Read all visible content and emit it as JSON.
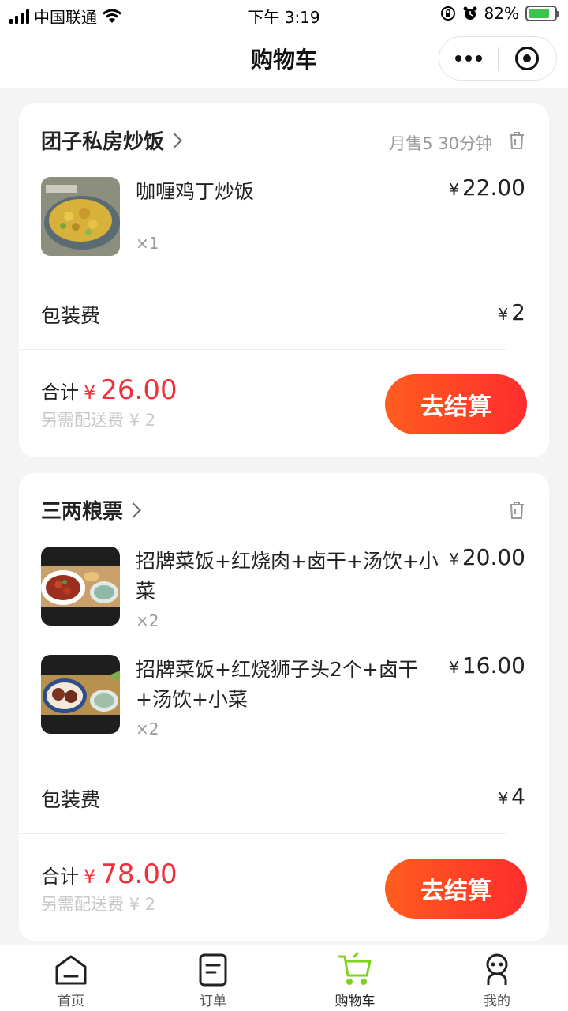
{
  "status_bar": {
    "carrier": "中国联通",
    "time": "下午 3:19",
    "battery_percent": "82%",
    "battery_level": 0.82
  },
  "nav": {
    "title": "购物车"
  },
  "shops": [
    {
      "name": "团子私房炒饭",
      "meta": "月售5  30分钟",
      "items": [
        {
          "name": "咖喱鸡丁炒饭",
          "qty": "×1",
          "price": "22.00"
        }
      ],
      "packaging_label": "包装费",
      "packaging_fee": "2",
      "total_label": "合计",
      "total": "26.00",
      "delivery_note": "另需配送费 ¥ 2",
      "checkout_label": "去结算"
    },
    {
      "name": "三两粮票",
      "meta": "",
      "items": [
        {
          "name": "招牌菜饭+红烧肉+卤干+汤饮+小菜",
          "qty": "×2",
          "price": "20.00"
        },
        {
          "name": "招牌菜饭+红烧狮子头2个+卤干+汤饮+小菜",
          "qty": "×2",
          "price": "16.00"
        }
      ],
      "packaging_label": "包装费",
      "packaging_fee": "4",
      "total_label": "合计",
      "total": "78.00",
      "delivery_note": "另需配送费 ¥ 2",
      "checkout_label": "去结算"
    }
  ],
  "currency": "¥",
  "tabs": [
    {
      "label": "首页",
      "icon": "home-icon"
    },
    {
      "label": "订单",
      "icon": "order-icon"
    },
    {
      "label": "购物车",
      "icon": "cart-icon"
    },
    {
      "label": "我的",
      "icon": "profile-icon"
    }
  ],
  "colors": {
    "accent_red": "#f0303a",
    "button_gradient_start": "#ff5d1e",
    "button_gradient_end": "#ff2d2d",
    "tab_active": "#7ed321"
  }
}
